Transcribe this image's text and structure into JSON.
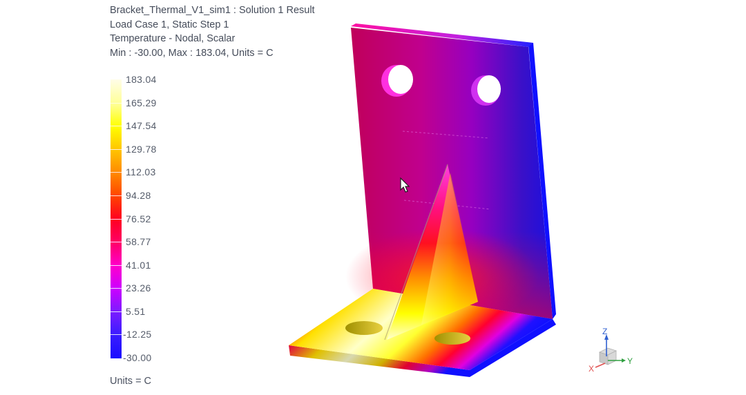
{
  "header": {
    "line1": "Bracket_Thermal_V1_sim1 : Solution 1 Result",
    "line2": "Load Case 1, Static Step 1",
    "line3": "Temperature - Nodal, Scalar",
    "line4": "Min : -30.00, Max : 183.04, Units = C"
  },
  "legend": {
    "labels": [
      "183.04",
      "165.29",
      "147.54",
      "129.78",
      "112.03",
      "94.28",
      "76.52",
      "58.77",
      "41.01",
      "23.26",
      "5.51",
      "-12.25",
      "-30.00"
    ],
    "colors": [
      "#fffde8",
      "#ffff99",
      "#ffff00",
      "#ffc400",
      "#ff8a00",
      "#ff4400",
      "#ff0020",
      "#ff0066",
      "#ff00cc",
      "#cc00ff",
      "#7a1cff",
      "#3a1cff",
      "#1a0cff"
    ],
    "min": -30.0,
    "max": 183.04,
    "units_label": "Units = C"
  },
  "model": {
    "name": "Bracket",
    "result": "Temperature - Nodal, Scalar"
  },
  "triad": {
    "x_label": "X",
    "y_label": "Y",
    "z_label": "Z",
    "x_color": "#e05050",
    "y_color": "#30a040",
    "z_color": "#3060d0"
  }
}
